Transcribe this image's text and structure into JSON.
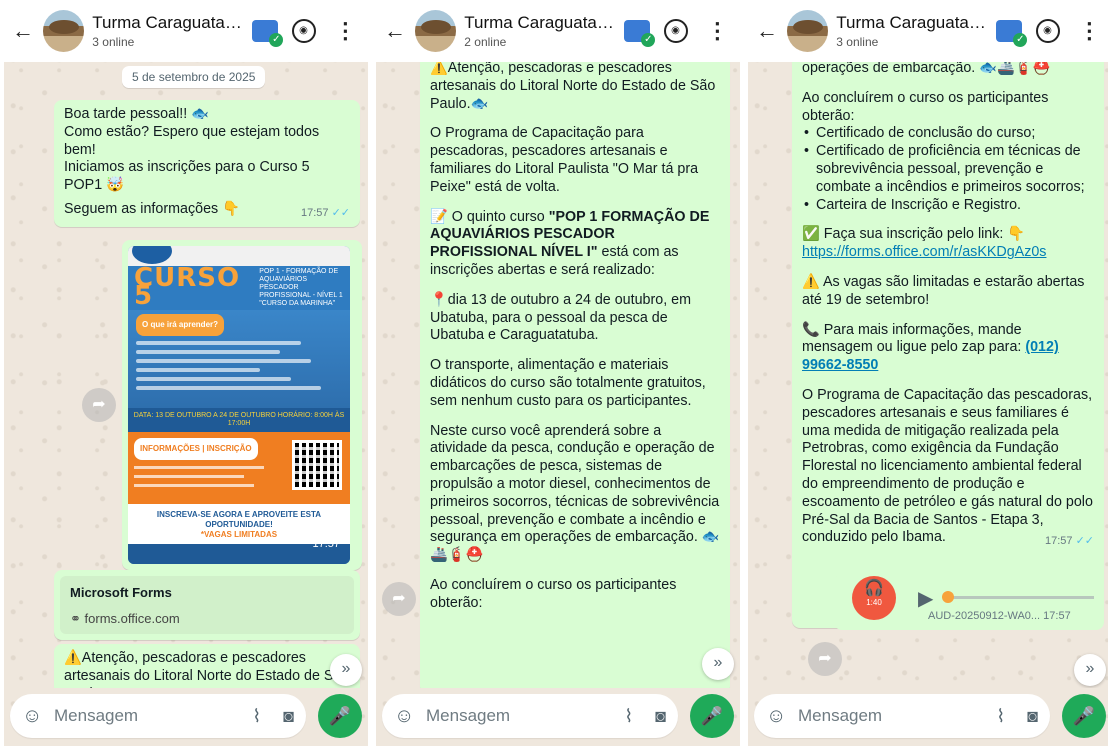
{
  "header": {
    "back_glyph": "←",
    "title": "Turma Caraguatat...",
    "menu_glyph": "⋮"
  },
  "panels": [
    {
      "online": "3 online"
    },
    {
      "online": "2 online"
    },
    {
      "online": "3 online"
    }
  ],
  "composer": {
    "placeholder": "Mensagem"
  },
  "panel1": {
    "date_chip": "5 de setembro de 2025",
    "msg1": {
      "l1": "Boa tarde pessoal!! 🐟",
      "l2": "Como estão? Espero que estejam todos bem!",
      "l3": "Iniciamos as inscrições para o Curso 5 POP1 🤯",
      "l4": "Seguem as informações 👇",
      "time": "17:57"
    },
    "poster": {
      "curso": "CURSO 5",
      "subtitle": "POP 1 - FORMAÇÃO DE AQUAVIÁRIOS PESCADOR PROFISSIONAL - NÍVEL 1 \"CURSO DA MARINHA\"",
      "pill": "O que irá aprender?",
      "dates": "DATA: 13 DE OUTUBRO A 24 DE OUTUBRO   HORÁRIO: 8:00H ÀS 17:00H",
      "contact_pill": "INFORMAÇÕES | INSCRIÇÃO",
      "cta1": "INSCREVA-SE AGORA E APROVEITE ESTA OPORTUNIDADE!",
      "cta2": "*VAGAS LIMITADAS",
      "time": "17:57"
    },
    "linkcard": {
      "title": "Microsoft Forms",
      "url": "forms.office.com"
    },
    "msg2": {
      "l1": "⚠️Atenção, pescadoras e pescadores artesanais do Litoral Norte do Estado de São Paulo. 🐟"
    }
  },
  "panel2": {
    "p1": "⚠️Atenção, pescadoras e pescadores artesanais do Litoral Norte do Estado de São Paulo.🐟",
    "p2": "O Programa de Capacitação para pescadoras, pescadores artesanais e familiares do Litoral Paulista \"O Mar tá pra Peixe\" está de volta.",
    "p3_pre": "📝 O quinto curso ",
    "p3_bold": "\"POP 1 FORMAÇÃO DE AQUAVIÁRIOS PESCADOR PROFISSIONAL NÍVEL I\"",
    "p3_post": " está com as inscrições abertas e será realizado:",
    "p4": "📍dia 13 de outubro a 24 de outubro, em Ubatuba, para o pessoal da pesca de Ubatuba e Caraguatatuba.",
    "p5": "O transporte, alimentação e materiais didáticos do curso são totalmente gratuitos, sem nenhum custo para os participantes.",
    "p6": "Neste curso você aprenderá sobre a atividade da pesca, condução e operação de embarcações de pesca, sistemas de propulsão a motor diesel, conhecimentos de primeiros socorros, técnicas de sobrevivência pessoal, prevenção e combate a incêndio e segurança em operações de embarcação. 🐟🚢🧯⛑️",
    "p7": "Ao concluírem o curso os participantes obterão:"
  },
  "panel3": {
    "p0": "operações de embarcação. 🐟🚢🧯⛑️",
    "p1": "Ao concluírem o curso os participantes obterão:",
    "items": [
      "Certificado de conclusão do curso;",
      "Certificado de proficiência em técnicas de sobrevivência pessoal, prevenção e combate a incêndios e primeiros socorros;",
      "Carteira de Inscrição e Registro."
    ],
    "p2_pre": "✅ Faça sua inscrição pelo link: 👇",
    "p2_link": "https://forms.office.com/r/asKKDgAz0s",
    "p3": "⚠️ As vagas são limitadas e estarão abertas até 19 de setembro!",
    "p4_pre": "📞 Para mais informações, mande mensagem ou ligue pelo zap para: ",
    "p4_phone": "(012) 99662-8550",
    "p5": "O Programa de Capacitação das pescadoras, pescadores artesanais e seus familiares é uma medida de mitigação realizada pela Petrobras, como exigência da Fundação Florestal no licenciamento ambiental federal do empreendimento de produção e escoamento de petróleo e gás natural do polo Pré-Sal da Bacia de Santos - Etapa 3, conduzido pelo Ibama.",
    "time": "17:57",
    "audio": {
      "duration": "1:40",
      "name": "AUD-20250912-WA0...",
      "time": "17:57"
    }
  }
}
